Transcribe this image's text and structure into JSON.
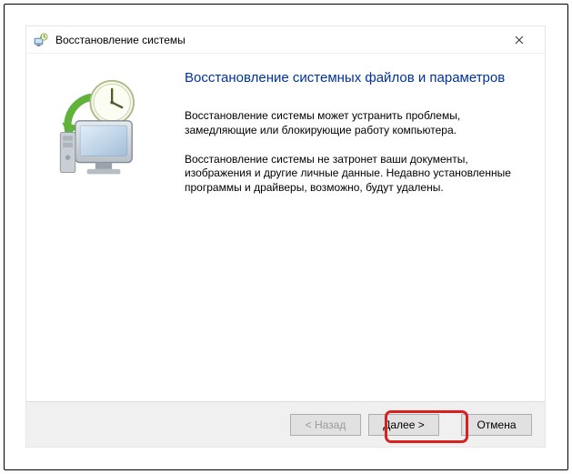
{
  "window": {
    "title": "Восстановление системы"
  },
  "content": {
    "heading": "Восстановление системных файлов и параметров",
    "para1": "Восстановление системы может устранить проблемы, замедляющие или блокирующие работу компьютера.",
    "para2": "Восстановление системы не затронет ваши документы, изображения и другие личные данные. Недавно установленные программы и драйверы, возможно, будут удалены."
  },
  "footer": {
    "back": "< Назад",
    "next": "Далее >",
    "cancel": "Отмена"
  }
}
